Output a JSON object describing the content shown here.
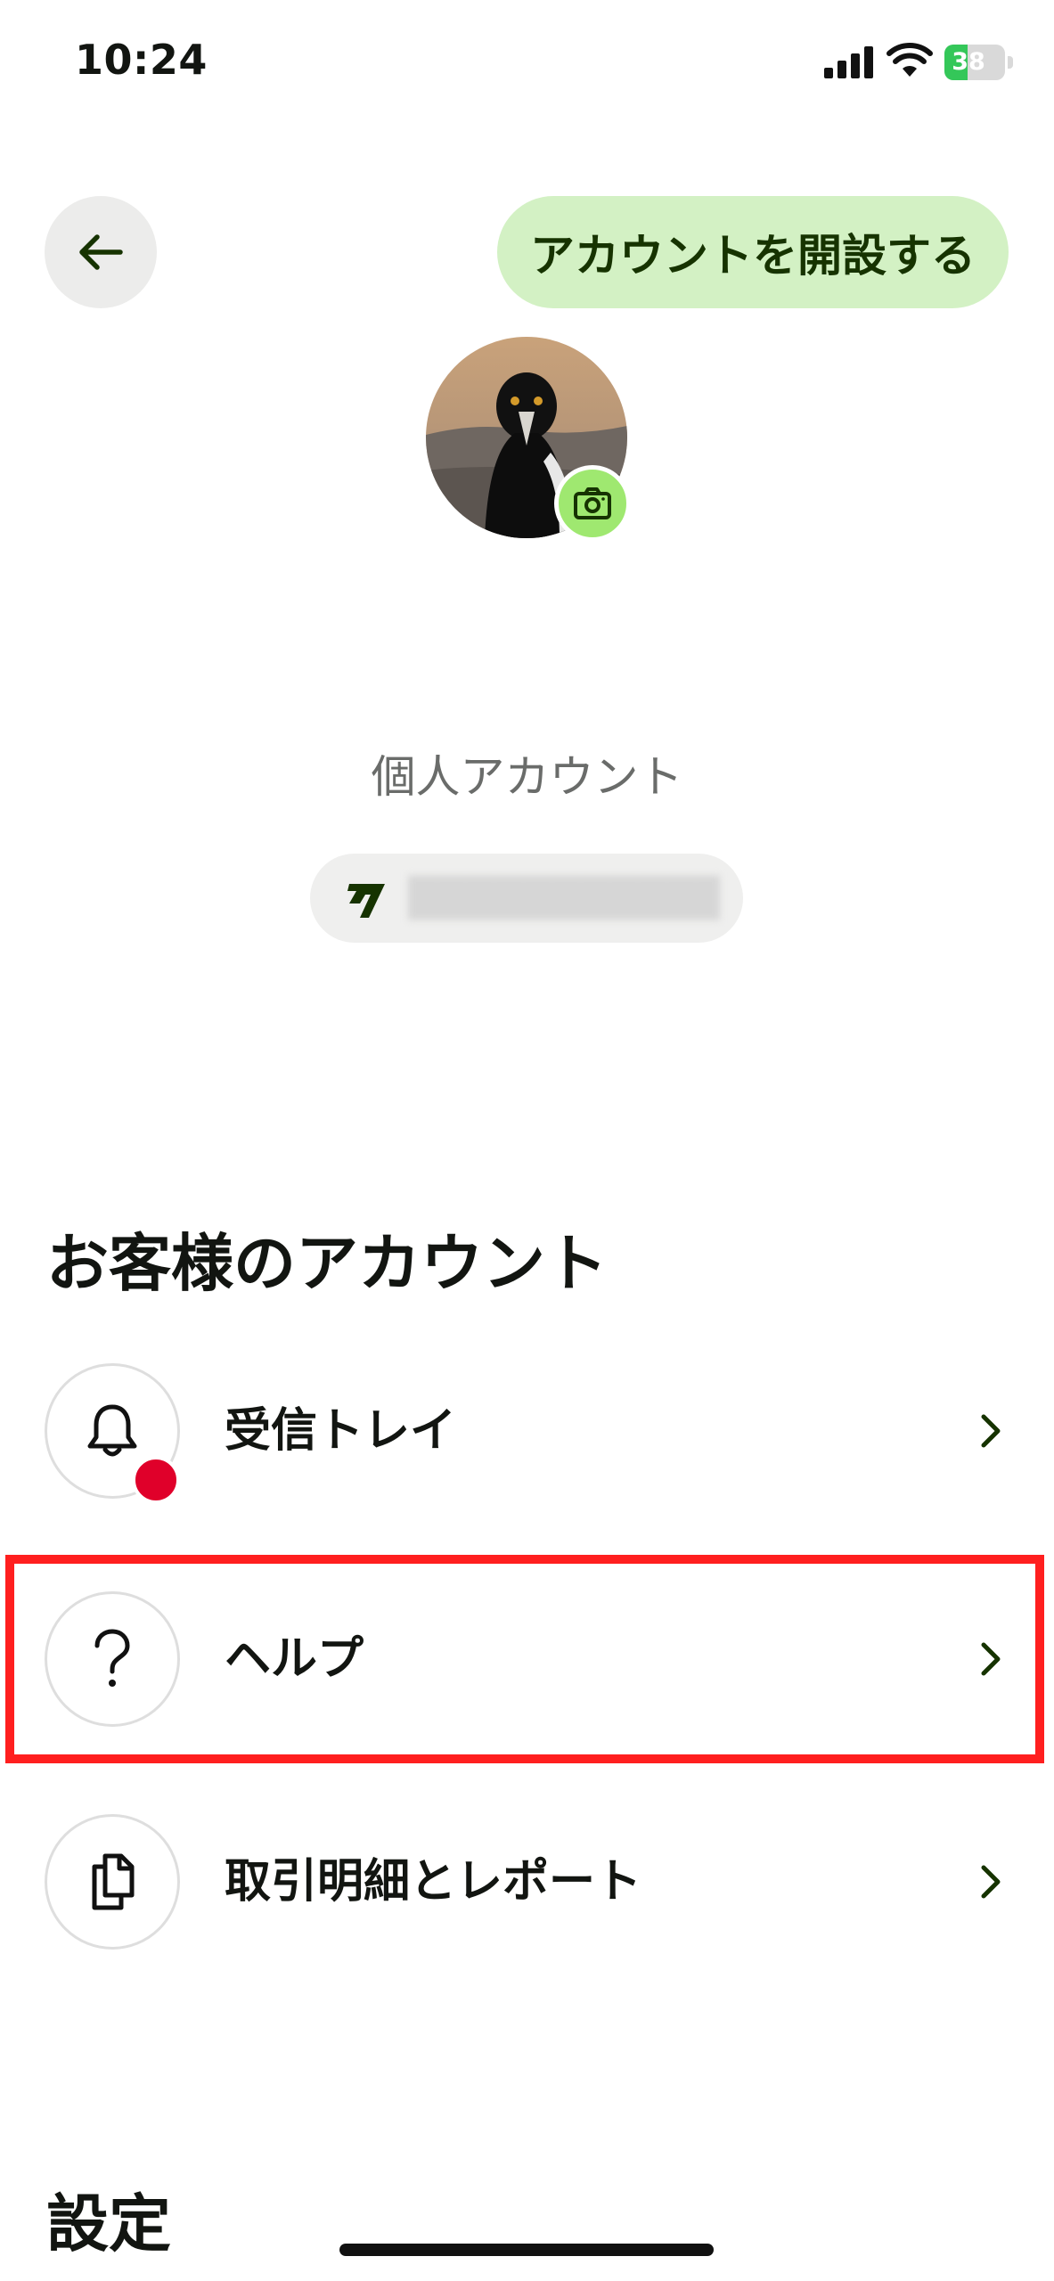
{
  "status_bar": {
    "time": "10:24",
    "battery_level": "38",
    "battery_fill_fraction": 0.38
  },
  "header": {
    "back_icon": "arrow-left-icon",
    "open_account_label": "アカウントを開設する"
  },
  "profile": {
    "avatar_icon": "magpie-photo",
    "camera_icon": "camera-icon",
    "account_type": "個人アカウント",
    "wisetag_icon": "wise-logo-icon"
  },
  "your_account": {
    "heading": "お客様のアカウント",
    "items": [
      {
        "label": "受信トレイ",
        "icon": "bell-icon",
        "has_notification": true
      },
      {
        "label": "ヘルプ",
        "icon": "question-icon"
      },
      {
        "label": "取引明細とレポート",
        "icon": "documents-icon"
      }
    ]
  },
  "settings": {
    "heading": "設定"
  },
  "colors": {
    "brand_green_light": "#d3f1c4",
    "brand_green": "#9fe870",
    "brand_dark_green": "#163300",
    "notification_red": "#e0002a",
    "highlight_red": "#ff1f1f"
  }
}
